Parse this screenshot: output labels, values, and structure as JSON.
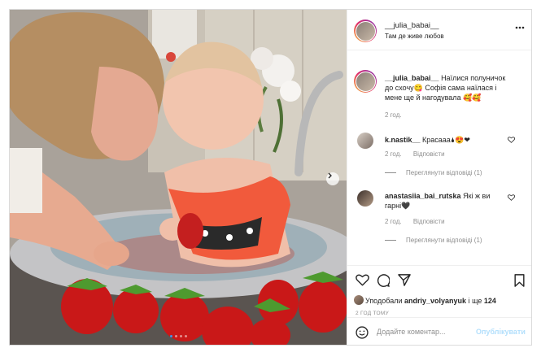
{
  "post": {
    "username": "__julia_babai__",
    "location": "Там де живе любов",
    "caption_user": "__julia_babai__",
    "caption_text": "Наїлися полуничок до схочу😋 Софія сама наїлася і мене ще й нагодувала 🥰🥰",
    "caption_time": "2 год.",
    "likes_prefix": "Уподобали",
    "likes_user": "andriy_volyanyuk",
    "likes_middle": "і ще",
    "likes_count": "124",
    "post_time": "2 ГОД ТОМУ",
    "comment_placeholder": "Додайте коментар...",
    "publish_label": "Опублікувати"
  },
  "comments": [
    {
      "user": "k.nastik__",
      "text": "Красааа🌢😍❤",
      "time": "2 год.",
      "reply_label": "Відповісти",
      "view_replies": "Переглянути відповіді (1)"
    },
    {
      "user": "anastasiia_bai_rutska",
      "text": "Які ж ви гарні🖤",
      "time": "2 год.",
      "reply_label": "Відповісти",
      "view_replies": "Переглянути відповіді (1)"
    }
  ],
  "icons": {
    "more": "more-options-icon",
    "like": "heart-icon",
    "comment": "comment-icon",
    "share": "share-icon",
    "save": "bookmark-icon",
    "emoji": "emoji-icon",
    "next": "chevron-right-icon"
  },
  "carousel": {
    "slides": 4,
    "active_slide": 1
  },
  "colors": {
    "link_blue": "#3897f0",
    "publish_disabled": "#b2dffc",
    "border": "#dbdbdb",
    "muted": "#8e8e8e"
  }
}
